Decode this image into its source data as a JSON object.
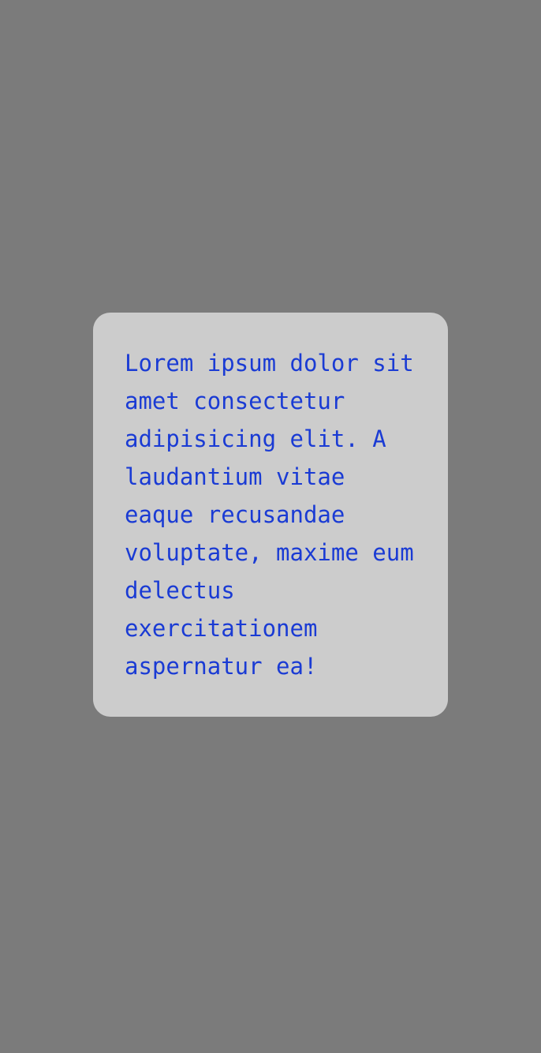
{
  "card": {
    "text": "Lorem ipsum dolor sit amet consectetur adipisicing elit. A laudantium vitae eaque recusandae voluptate, maxime eum delectus exercitationem aspernatur ea!"
  },
  "colors": {
    "page_background": "#7b7b7b",
    "card_background": "#cccccc",
    "text": "#1a3bd4"
  }
}
